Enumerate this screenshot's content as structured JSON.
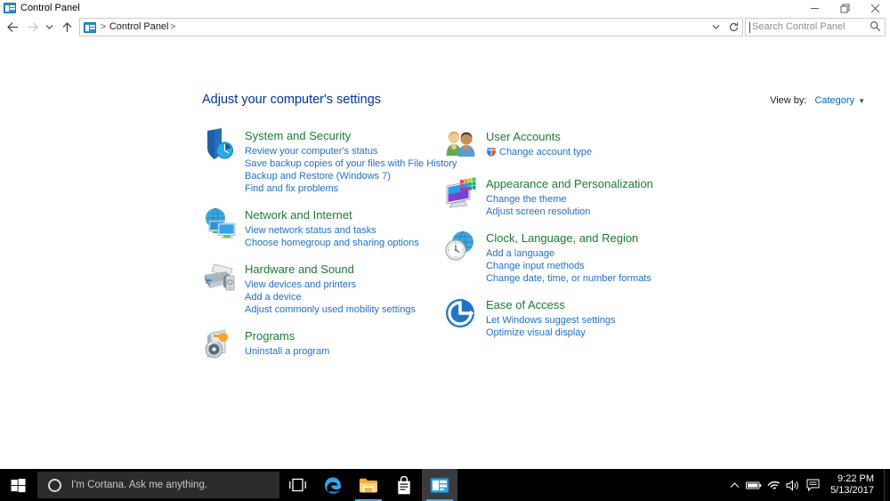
{
  "window": {
    "title": "Control Panel",
    "title_icon": "control-panel-icon",
    "controls": {
      "minimize": "minimize-icon",
      "maximize": "restore-icon",
      "close": "close-icon"
    }
  },
  "navbar": {
    "back": "back-arrow-icon",
    "forward": "forward-arrow-icon",
    "recent": "recent-pages-chevron-icon",
    "up": "up-arrow-icon",
    "breadcrumb": {
      "icon": "control-panel-icon",
      "items": [
        "Control Panel"
      ],
      "separator": ">"
    },
    "address_chevron": "address-dropdown-chevron-icon",
    "refresh": "refresh-icon"
  },
  "search": {
    "placeholder": "Search Control Panel",
    "value": "",
    "icon": "search-icon"
  },
  "main": {
    "heading": "Adjust your computer's settings",
    "view_by": {
      "label": "View by:",
      "value": "Category",
      "arrow": "chevron-down-icon"
    },
    "columns": {
      "left": [
        {
          "icon": "shield-clock-icon",
          "title": "System and Security",
          "links": [
            {
              "text": "Review your computer's status",
              "shield": false
            },
            {
              "text": "Save backup copies of your files with File History",
              "shield": false
            },
            {
              "text": "Backup and Restore (Windows 7)",
              "shield": false
            },
            {
              "text": "Find and fix problems",
              "shield": false
            }
          ]
        },
        {
          "icon": "globe-monitors-icon",
          "title": "Network and Internet",
          "links": [
            {
              "text": "View network status and tasks",
              "shield": false
            },
            {
              "text": "Choose homegroup and sharing options",
              "shield": false
            }
          ]
        },
        {
          "icon": "printer-speaker-icon",
          "title": "Hardware and Sound",
          "links": [
            {
              "text": "View devices and printers",
              "shield": false
            },
            {
              "text": "Add a device",
              "shield": false
            },
            {
              "text": "Adjust commonly used mobility settings",
              "shield": false
            }
          ]
        },
        {
          "icon": "programs-disc-icon",
          "title": "Programs",
          "links": [
            {
              "text": "Uninstall a program",
              "shield": false
            }
          ]
        }
      ],
      "right": [
        {
          "icon": "user-accounts-icon",
          "title": "User Accounts",
          "links": [
            {
              "text": "Change account type",
              "shield": true
            }
          ]
        },
        {
          "icon": "appearance-monitor-icon",
          "title": "Appearance and Personalization",
          "links": [
            {
              "text": "Change the theme",
              "shield": false
            },
            {
              "text": "Adjust screen resolution",
              "shield": false
            }
          ]
        },
        {
          "icon": "clock-globe-icon",
          "title": "Clock, Language, and Region",
          "links": [
            {
              "text": "Add a language",
              "shield": false
            },
            {
              "text": "Change input methods",
              "shield": false
            },
            {
              "text": "Change date, time, or number formats",
              "shield": false
            }
          ]
        },
        {
          "icon": "ease-of-access-icon",
          "title": "Ease of Access",
          "links": [
            {
              "text": "Let Windows suggest settings",
              "shield": false
            },
            {
              "text": "Optimize visual display",
              "shield": false
            }
          ]
        }
      ]
    }
  },
  "taskbar": {
    "start": "windows-start-icon",
    "cortana": {
      "icon": "cortana-circle-icon",
      "placeholder": "I'm Cortana. Ask me anything."
    },
    "items": [
      {
        "name": "task-view-icon",
        "label": "Task View"
      },
      {
        "name": "edge-icon",
        "label": "Microsoft Edge"
      },
      {
        "name": "file-explorer-icon",
        "label": "File Explorer"
      },
      {
        "name": "store-icon",
        "label": "Store"
      },
      {
        "name": "control-panel-taskbar-icon",
        "label": "Control Panel"
      }
    ],
    "tray": {
      "show_hidden": "chevron-up-icon",
      "battery": "battery-icon",
      "network": "wifi-icon",
      "volume": "speaker-icon",
      "action_center": "action-center-icon",
      "time": "9:22 PM",
      "date": "5/13/2017"
    }
  },
  "colors": {
    "heading_blue": "#003399",
    "category_green": "#1a7a32",
    "link_blue": "#1f6fc4",
    "taskbar_black": "#000000",
    "accent_blue": "#0078d7"
  }
}
